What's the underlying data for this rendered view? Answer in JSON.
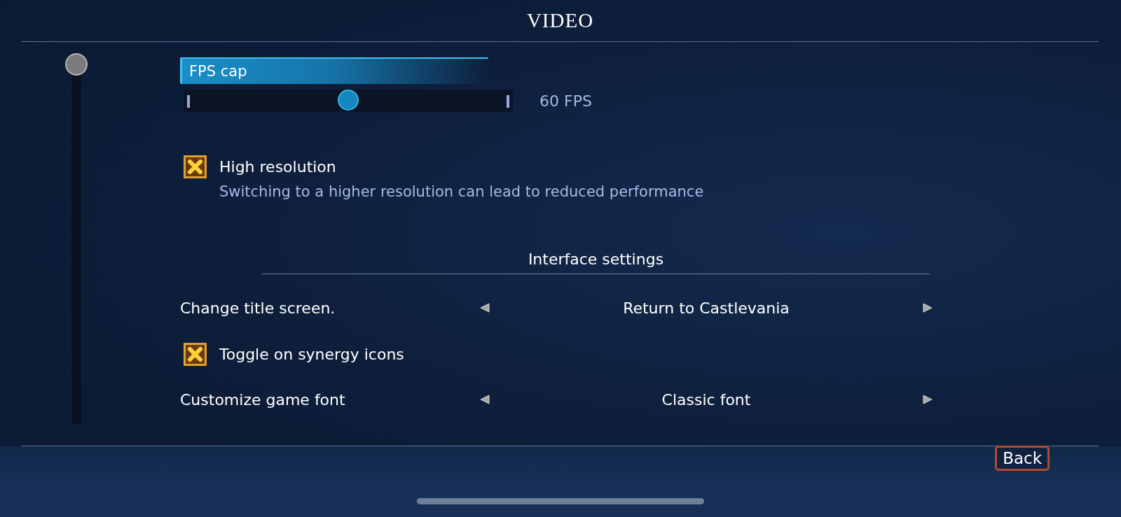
{
  "title": "VIDEO",
  "options": [
    {
      "kind": "slider",
      "label": "FPS cap",
      "selected": true,
      "level": 0.5,
      "reading": "60 FPS"
    },
    {
      "kind": "checkbox",
      "label": "High resolution",
      "selected": false,
      "checked": true,
      "description": "Switching to a higher resolution can lead to reduced performance"
    },
    {
      "kind": "heading",
      "label": "Interface settings"
    },
    {
      "kind": "selector",
      "label": "Change title screen.",
      "selected": false,
      "value": "Return to Castlevania"
    },
    {
      "kind": "checkbox",
      "label": "Toggle on synergy icons",
      "selected": false,
      "checked": true
    },
    {
      "kind": "selector",
      "label": "Customize game font",
      "selected": false,
      "value": "Classic font"
    }
  ],
  "back_button": "Back"
}
